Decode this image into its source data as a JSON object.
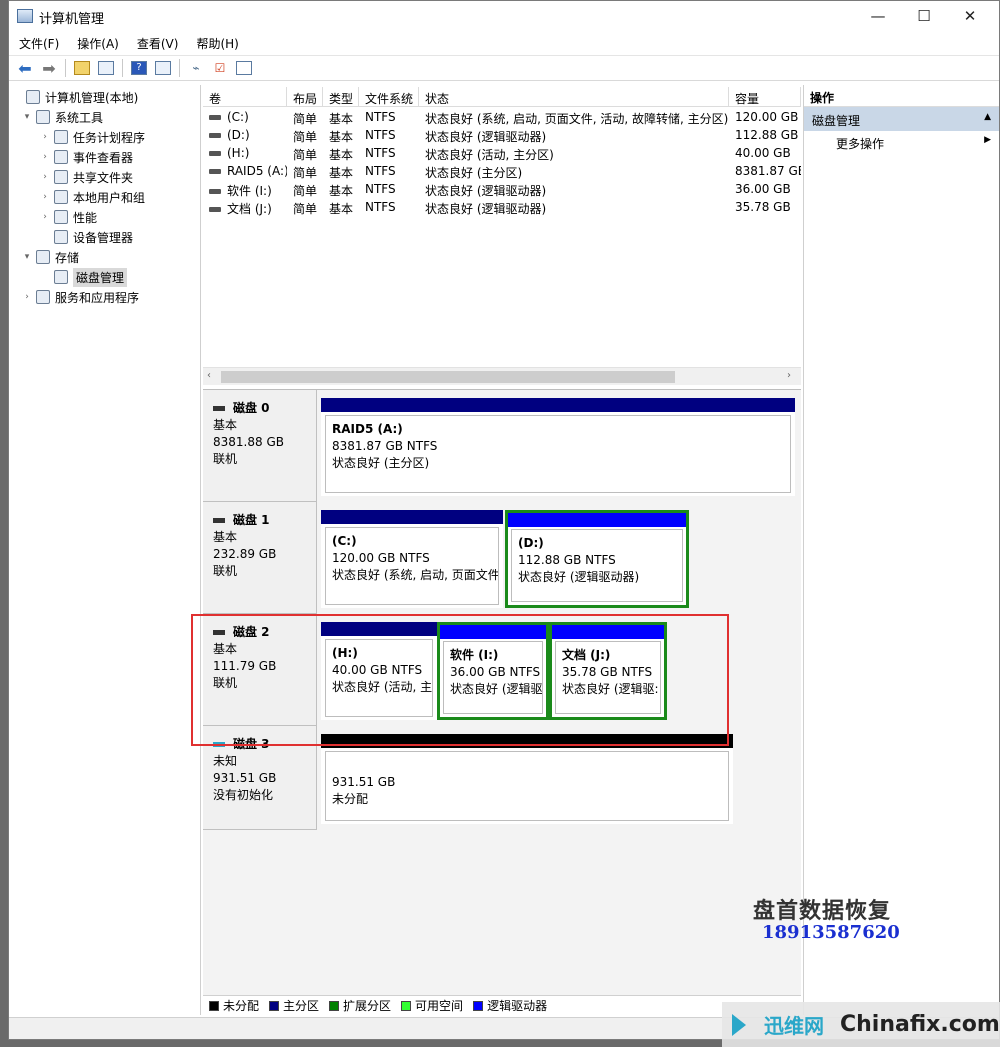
{
  "window": {
    "title": "计算机管理"
  },
  "menu": [
    "文件(F)",
    "操作(A)",
    "查看(V)",
    "帮助(H)"
  ],
  "tree": [
    {
      "label": "计算机管理(本地)",
      "level": 0,
      "arrow": "",
      "selected": false
    },
    {
      "label": "系统工具",
      "level": 1,
      "arrow": "▾",
      "selected": false
    },
    {
      "label": "任务计划程序",
      "level": 2,
      "arrow": "›",
      "selected": false
    },
    {
      "label": "事件查看器",
      "level": 2,
      "arrow": "›",
      "selected": false
    },
    {
      "label": "共享文件夹",
      "level": 2,
      "arrow": "›",
      "selected": false
    },
    {
      "label": "本地用户和组",
      "level": 2,
      "arrow": "›",
      "selected": false
    },
    {
      "label": "性能",
      "level": 2,
      "arrow": "›",
      "selected": false
    },
    {
      "label": "设备管理器",
      "level": 2,
      "arrow": "",
      "selected": false
    },
    {
      "label": "存储",
      "level": 1,
      "arrow": "▾",
      "selected": false
    },
    {
      "label": "磁盘管理",
      "level": 2,
      "arrow": "",
      "selected": true
    },
    {
      "label": "服务和应用程序",
      "level": 1,
      "arrow": "›",
      "selected": false
    }
  ],
  "volume_headers": [
    "卷",
    "布局",
    "类型",
    "文件系统",
    "状态",
    "容量"
  ],
  "volumes": [
    [
      "(C:)",
      "简单",
      "基本",
      "NTFS",
      "状态良好 (系统, 启动, 页面文件, 活动, 故障转储, 主分区)",
      "120.00 GB"
    ],
    [
      "(D:)",
      "简单",
      "基本",
      "NTFS",
      "状态良好 (逻辑驱动器)",
      "112.88 GB"
    ],
    [
      "(H:)",
      "简单",
      "基本",
      "NTFS",
      "状态良好 (活动, 主分区)",
      "40.00 GB"
    ],
    [
      "RAID5 (A:)",
      "简单",
      "基本",
      "NTFS",
      "状态良好 (主分区)",
      "8381.87 GB"
    ],
    [
      "软件 (I:)",
      "简单",
      "基本",
      "NTFS",
      "状态良好 (逻辑驱动器)",
      "36.00 GB"
    ],
    [
      "文档 (J:)",
      "简单",
      "基本",
      "NTFS",
      "状态良好 (逻辑驱动器)",
      "35.78 GB"
    ]
  ],
  "disks": [
    {
      "name": "磁盘 0",
      "type": "基本",
      "size": "8381.88 GB",
      "state": "联机",
      "partitions": [
        {
          "name": "RAID5  (A:)",
          "size": "8381.87 GB NTFS",
          "status": "状态良好 (主分区)",
          "kind": "primary"
        }
      ]
    },
    {
      "name": "磁盘 1",
      "type": "基本",
      "size": "232.89 GB",
      "state": "联机",
      "partitions": [
        {
          "name": "(C:)",
          "size": "120.00 GB NTFS",
          "status": "状态良好 (系统, 启动, 页面文件,",
          "kind": "primary"
        },
        {
          "name": "(D:)",
          "size": "112.88 GB NTFS",
          "status": "状态良好 (逻辑驱动器)",
          "kind": "logical"
        }
      ]
    },
    {
      "name": "磁盘 2",
      "type": "基本",
      "size": "111.79 GB",
      "state": "联机",
      "partitions": [
        {
          "name": "(H:)",
          "size": "40.00 GB NTFS",
          "status": "状态良好 (活动, 主",
          "kind": "primary"
        },
        {
          "name": "软件  (I:)",
          "size": "36.00 GB NTFS",
          "status": "状态良好 (逻辑驱:",
          "kind": "logical"
        },
        {
          "name": "文档  (J:)",
          "size": "35.78 GB NTFS",
          "status": "状态良好 (逻辑驱:",
          "kind": "logical"
        }
      ]
    },
    {
      "name": "磁盘 3",
      "type": "未知",
      "size": "931.51 GB",
      "state": "没有初始化",
      "partitions": [
        {
          "name": "",
          "size": "931.51 GB",
          "status": "未分配",
          "kind": "unallocated"
        }
      ]
    }
  ],
  "legend": [
    {
      "label": "未分配",
      "color": "#000000"
    },
    {
      "label": "主分区",
      "color": "#000080"
    },
    {
      "label": "扩展分区",
      "color": "#008000"
    },
    {
      "label": "可用空间",
      "color": "#33ff33"
    },
    {
      "label": "逻辑驱动器",
      "color": "#0000ff"
    }
  ],
  "actions": {
    "header": "操作",
    "section": "磁盘管理",
    "item": "更多操作"
  },
  "watermark": {
    "text": "盘首数据恢复",
    "phone": "18913587620",
    "site_cn": "迅维网",
    "site_en": "Chinafix.com"
  },
  "colors": {
    "primary": "#000080",
    "logical": "#0000ff",
    "extended": "#1a8a1a",
    "unallocated": "#000000",
    "highlight": "#e03030"
  }
}
